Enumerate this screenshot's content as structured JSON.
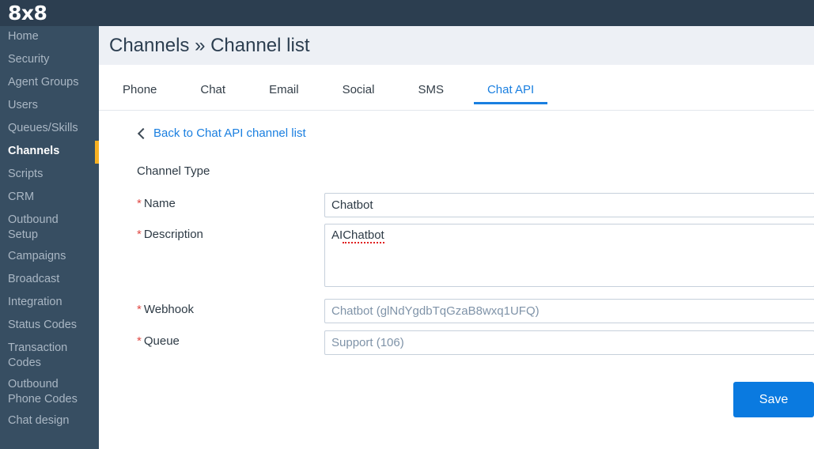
{
  "brand": {
    "logo_text": "8x8"
  },
  "sidebar": {
    "items": [
      {
        "label": "Home",
        "active": false
      },
      {
        "label": "Security",
        "active": false
      },
      {
        "label": "Agent Groups",
        "active": false
      },
      {
        "label": "Users",
        "active": false
      },
      {
        "label": "Queues/Skills",
        "active": false
      },
      {
        "label": "Channels",
        "active": true
      },
      {
        "label": "Scripts",
        "active": false
      },
      {
        "label": "CRM",
        "active": false
      },
      {
        "label": "Outbound Setup",
        "active": false
      },
      {
        "label": "Campaigns",
        "active": false
      },
      {
        "label": "Broadcast",
        "active": false
      },
      {
        "label": "Integration",
        "active": false
      },
      {
        "label": "Status Codes",
        "active": false
      },
      {
        "label": "Transaction Codes",
        "active": false
      },
      {
        "label": "Outbound Phone Codes",
        "active": false
      },
      {
        "label": "Chat design",
        "active": false
      }
    ],
    "active_accent_color": "#f9b122",
    "background_color": "#374e62"
  },
  "header": {
    "title": "Channels » Channel list",
    "background_color": "#edf0f5"
  },
  "tabs": {
    "items": [
      {
        "label": "Phone",
        "active": false
      },
      {
        "label": "Chat",
        "active": false
      },
      {
        "label": "Email",
        "active": false
      },
      {
        "label": "Social",
        "active": false
      },
      {
        "label": "SMS",
        "active": false
      },
      {
        "label": "Chat API",
        "active": true
      }
    ],
    "active_color": "#1a7fe0"
  },
  "back_link": {
    "label": "Back to Chat API channel list",
    "icon": "chevron-left-icon",
    "color": "#1a7fe0"
  },
  "form": {
    "required_marker": "*",
    "required_color": "#e04a45",
    "fields": {
      "channel_type": {
        "label": "Channel Type",
        "required": false,
        "value": ""
      },
      "name": {
        "label": "Name",
        "required": true,
        "value": "Chatbot"
      },
      "description": {
        "label": "Description",
        "required": true,
        "value": "AI Chatbot",
        "spellcheck_word": "Chatbot",
        "prefix": "AI "
      },
      "webhook": {
        "label": "Webhook",
        "required": true,
        "value": "Chatbot (glNdYgdbTqGzaB8wxq1UFQ)",
        "readonly": true
      },
      "queue": {
        "label": "Queue",
        "required": true,
        "value": "Support (106)",
        "readonly": true
      }
    }
  },
  "actions": {
    "save_label": "Save",
    "save_color": "#0a7ae0"
  }
}
